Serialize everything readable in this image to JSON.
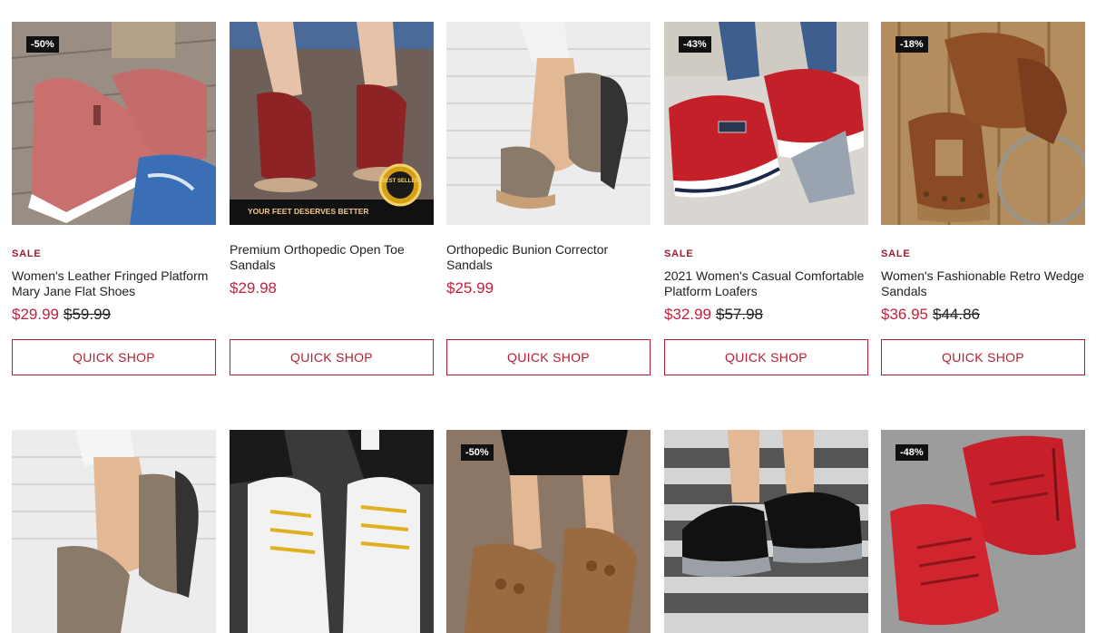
{
  "products_row1": [
    {
      "badge": "-50%",
      "sale": "SALE",
      "title": "Women's Leather Fringed Platform Mary Jane Flat Shoes",
      "price": "$29.99",
      "compare": "$59.99",
      "button": "QUICK SHOP",
      "img_bg": "#8a7a6a",
      "shoe_color": "#c9706f"
    },
    {
      "badge": "",
      "sale": "",
      "title": "Premium Orthopedic Open Toe Sandals",
      "price": "$29.98",
      "compare": "",
      "button": "QUICK SHOP",
      "img_bg": "#7a6a5e",
      "shoe_color": "#8e2326",
      "banner": "YOUR FEET DESERVES BETTER",
      "seal": "BEST SELLER"
    },
    {
      "badge": "",
      "sale": "",
      "title": "Orthopedic Bunion Corrector Sandals",
      "price": "$25.99",
      "compare": "",
      "button": "QUICK SHOP",
      "img_bg": "#e8e8e8",
      "shoe_color": "#8a7a6a"
    },
    {
      "badge": "-43%",
      "sale": "SALE",
      "title": "2021 Women's Casual Comfortable Platform Loafers",
      "price": "$32.99",
      "compare": "$57.98",
      "button": "QUICK SHOP",
      "img_bg": "#d8d5d0",
      "shoe_color": "#c4202a"
    },
    {
      "badge": "-18%",
      "sale": "SALE",
      "title": "Women's Fashionable Retro Wedge Sandals",
      "price": "$36.95",
      "compare": "$44.86",
      "button": "QUICK SHOP",
      "img_bg": "#b08a5c",
      "shoe_color": "#8a4a24"
    }
  ],
  "products_row2": [
    {
      "badge": "",
      "img_bg": "#ececec",
      "shoe_color": "#8a7a6a"
    },
    {
      "badge": "",
      "img_bg": "#3a3a3a",
      "shoe_color": "#f2f2f2"
    },
    {
      "badge": "-50%",
      "img_bg": "#8a7060",
      "shoe_color": "#9a6a40"
    },
    {
      "badge": "",
      "img_bg": "#5a5a5a",
      "shoe_color": "#111111"
    },
    {
      "badge": "-48%",
      "img_bg": "#9c9c9c",
      "shoe_color": "#c8202a"
    }
  ],
  "colors": {
    "accent": "#b71c32",
    "sale_label": "#9b1b30",
    "price": "#c4213f"
  }
}
